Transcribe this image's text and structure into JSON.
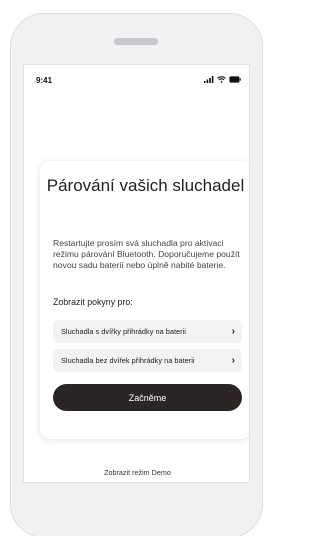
{
  "status_bar": {
    "time": "9:41",
    "icons": [
      "signal-icon",
      "wifi-icon",
      "battery-icon"
    ]
  },
  "card": {
    "title": "Párování vašich sluchadel",
    "description": "Restartujte prosím svá sluchadla pro aktivaci režimu párování Bluetooth. Doporučujeme použít novou sadu baterií nebo úplně nabité baterie.",
    "section_label": "Zobrazit pokyny pro:",
    "options": [
      {
        "label": "Sluchadla s dvířky přihrádky na baterii",
        "icon": "chevron-right-icon"
      },
      {
        "label": "Sluchadla bez dvířek přihrádky na baterii",
        "icon": "chevron-right-icon"
      }
    ],
    "primary_button": "Začněme"
  },
  "footer": {
    "demo_link": "Zobrazit režim Demo"
  },
  "colors": {
    "primary_button_bg": "#2b2525",
    "option_bg": "#f2f2f4",
    "phone_shell": "#f1f1f3"
  }
}
